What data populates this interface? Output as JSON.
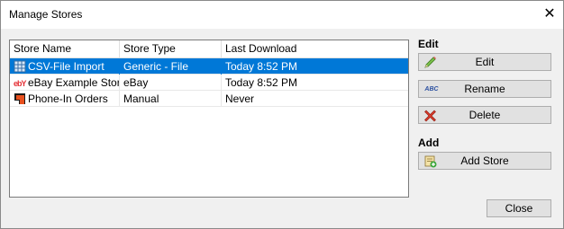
{
  "window": {
    "title": "Manage Stores"
  },
  "table": {
    "columns": [
      "Store Name",
      "Store Type",
      "Last Download"
    ],
    "rows": [
      {
        "name": "CSV-File Import",
        "type": "Generic - File",
        "last": "Today 8:52 PM",
        "icon": "csv-file-icon",
        "selected": true
      },
      {
        "name": "eBay Example Store",
        "type": "eBay",
        "last": "Today 8:52 PM",
        "icon": "ebay-logo-icon",
        "selected": false
      },
      {
        "name": "Phone-In Orders",
        "type": "Manual",
        "last": "Never",
        "icon": "manual-order-icon",
        "selected": false
      }
    ]
  },
  "edit_section": {
    "title": "Edit",
    "edit_label": "Edit",
    "rename_label": "Rename",
    "delete_label": "Delete"
  },
  "add_section": {
    "title": "Add",
    "add_label": "Add Store"
  },
  "footer": {
    "close_label": "Close"
  },
  "icons": {
    "rename_text": "ABC",
    "ebay_text": "ebY"
  },
  "colors": {
    "selection": "#0078d7",
    "button_face": "#e1e1e1"
  }
}
